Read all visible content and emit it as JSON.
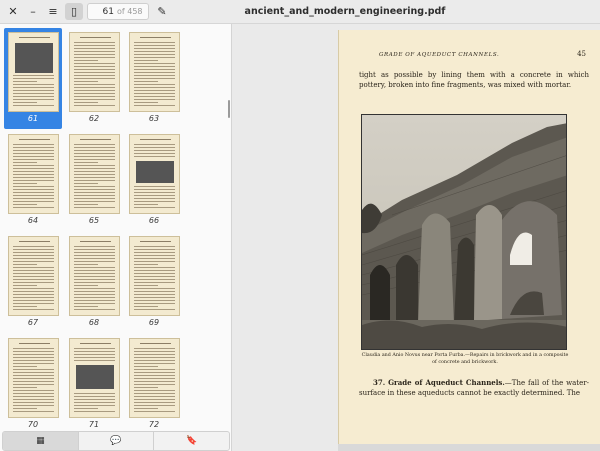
{
  "window": {
    "title": "ancient_and_modern_engineering.pdf"
  },
  "toolbar": {
    "close_glyph": "✕",
    "minimize_glyph": "–",
    "menu_glyph": "≡",
    "sidebar_toggle_glyph": "▯",
    "current_page": "61",
    "total_pages": "of 458",
    "annotate_glyph": "✎"
  },
  "sidebar": {
    "selected_page": "61",
    "thumbnails": [
      {
        "page": "61"
      },
      {
        "page": "62"
      },
      {
        "page": "63"
      },
      {
        "page": "64"
      },
      {
        "page": "65"
      },
      {
        "page": "66"
      },
      {
        "page": "67"
      },
      {
        "page": "68"
      },
      {
        "page": "69"
      },
      {
        "page": "70"
      },
      {
        "page": "71"
      },
      {
        "page": "72"
      }
    ],
    "tabs": [
      {
        "name": "thumbnails",
        "glyph": "▦",
        "active": true
      },
      {
        "name": "annotations",
        "glyph": "💬",
        "active": false
      },
      {
        "name": "bookmarks",
        "glyph": "🔖",
        "active": false
      }
    ]
  },
  "document": {
    "running_head": "GRADE OF AQUEDUCT CHANNELS.",
    "page_number": "45",
    "top_text": "tight as possible by lining them with a concrete in which pottery, broken into fine fragments, was mixed with mortar.",
    "caption": "Claudia and Anio Novus near Porta Furba.—Repairs in brickwork and in a composite of concrete and brickwork.",
    "section_number": "37.",
    "section_heading": "Grade of Aqueduct Channels.",
    "section_text": "—The fall of the water-surface in these aqueducts cannot be exactly determined. The"
  },
  "colors": {
    "accent": "#3584e4",
    "page_paper": "#f6ecd1",
    "toolbar_bg": "#ebebeb"
  }
}
